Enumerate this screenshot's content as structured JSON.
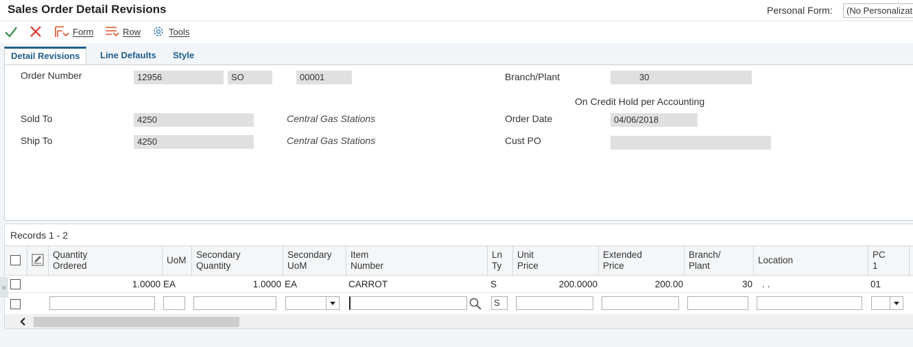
{
  "window": {
    "title": "Sales Order Detail Revisions",
    "personal_form_label": "Personal Form:",
    "personal_form_value": "(No Personalization)"
  },
  "toolbar": {
    "form_label": "Form",
    "row_label": "Row",
    "tools_label": "Tools"
  },
  "tabs": [
    {
      "label": "Detail Revisions",
      "active": true
    },
    {
      "label": "Line Defaults",
      "active": false
    },
    {
      "label": "Style",
      "active": false
    }
  ],
  "header": {
    "order_number_label": "Order Number",
    "order_number": "12956",
    "order_type": "SO",
    "order_company": "00001",
    "branch_plant_label": "Branch/Plant",
    "branch_plant": "30",
    "credit_hold_text": "On Credit Hold per Accounting",
    "sold_to_label": "Sold To",
    "sold_to": "4250",
    "sold_to_name": "Central Gas Stations",
    "ship_to_label": "Ship To",
    "ship_to": "4250",
    "ship_to_name": "Central Gas Stations",
    "order_date_label": "Order Date",
    "order_date": "04/06/2018",
    "cust_po_label": "Cust PO",
    "cust_po": ""
  },
  "grid": {
    "records_label": "Records 1 - 2",
    "columns": [
      {
        "line1": "Quantity",
        "line2": "Ordered"
      },
      {
        "line1": "UoM",
        "line2": ""
      },
      {
        "line1": "Secondary",
        "line2": "Quantity"
      },
      {
        "line1": "Secondary",
        "line2": "UoM"
      },
      {
        "line1": "Item",
        "line2": "Number"
      },
      {
        "line1": "Ln",
        "line2": "Ty"
      },
      {
        "line1": "Unit",
        "line2": "Price"
      },
      {
        "line1": "Extended",
        "line2": "Price"
      },
      {
        "line1": "Branch/",
        "line2": "Plant"
      },
      {
        "line1": "Location",
        "line2": ""
      },
      {
        "line1": "PC",
        "line2": "1"
      }
    ],
    "rows": [
      {
        "qty_ordered": "1.0000",
        "uom": "EA",
        "sec_qty": "1.0000",
        "sec_uom": "EA",
        "item_number": "CARROT",
        "ln_ty": "S",
        "unit_price": "200.0000",
        "extended_price": "200.00",
        "branch_plant": "30",
        "location": ". .",
        "pc1": "01"
      }
    ],
    "new_row": {
      "ln_ty": "S"
    }
  },
  "colors": {
    "accent": "#1f5d8c",
    "ok_green": "#2e8b3e",
    "cancel_red": "#d9342b",
    "row_icon_red": "#d9532b"
  },
  "icons": [
    "check-icon",
    "close-icon",
    "form-icon",
    "row-icon",
    "gear-icon",
    "edit-icon",
    "search-icon",
    "chevron-left-icon",
    "double-chevron-left-icon"
  ]
}
